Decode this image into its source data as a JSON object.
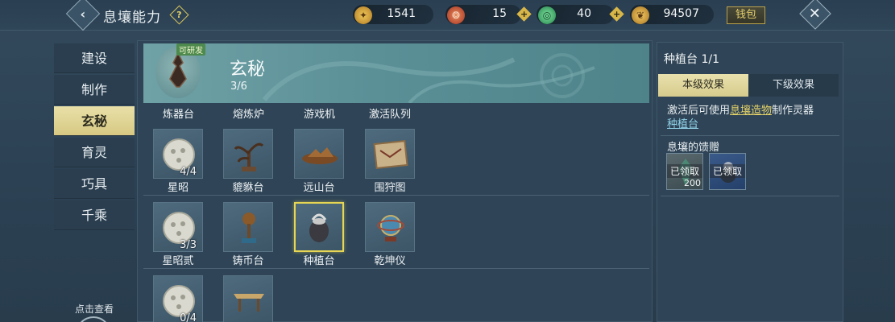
{
  "header": {
    "title": "息壤能力",
    "help_label": "?",
    "back_label": "‹",
    "close_label": "✕",
    "wallet_label": "钱包",
    "resources": [
      {
        "icon": "gold-shell-icon",
        "value": "1541",
        "color": "#d8a238"
      },
      {
        "icon": "red-coin-icon",
        "value": "15",
        "color": "#c9523a"
      },
      {
        "icon": "jade-ring-icon",
        "value": "40",
        "color": "#3fb56a"
      },
      {
        "icon": "gold-leaf-icon",
        "value": "94507",
        "color": "#d6a23c"
      }
    ],
    "plus_label": "+"
  },
  "nav": {
    "items": [
      "建设",
      "制作",
      "玄秘",
      "育灵",
      "巧具",
      "千乘"
    ],
    "active_index": 2,
    "click_view": "点击查看"
  },
  "banner": {
    "badge": "可研发",
    "title": "玄秘",
    "progress": "3/6"
  },
  "grid": {
    "column_headers": [
      "炼器台",
      "熔炼炉",
      "游戏机",
      "激活队列"
    ],
    "rows": [
      [
        {
          "label": "星昭",
          "count": "4/4",
          "icon": "star-disc-icon"
        },
        {
          "label": "貔貅台",
          "count": "",
          "icon": "bonsai-tree-icon"
        },
        {
          "label": "远山台",
          "count": "",
          "icon": "mountain-tray-icon"
        },
        {
          "label": "围狩图",
          "count": "",
          "icon": "hunting-map-icon"
        }
      ],
      [
        {
          "label": "星昭贰",
          "count": "3/3",
          "icon": "star-disc-icon"
        },
        {
          "label": "铸币台",
          "count": "",
          "icon": "coin-stand-icon"
        },
        {
          "label": "种植台",
          "count": "",
          "icon": "planter-pot-icon",
          "selected": true
        },
        {
          "label": "乾坤仪",
          "count": "",
          "icon": "globe-instrument-icon"
        }
      ],
      [
        {
          "label": "",
          "count": "0/4",
          "icon": "star-disc-icon"
        },
        {
          "label": "",
          "count": "",
          "icon": "wooden-table-icon"
        }
      ]
    ]
  },
  "detail": {
    "title": "种植台 1/1",
    "tabs": [
      "本级效果",
      "下级效果"
    ],
    "desc_prefix": "激活后可使用",
    "desc_link": "息壤造物",
    "desc_suffix": "制作灵器",
    "desc_link2": "种植台",
    "gift_title": "息壤的馈赠",
    "rewards": [
      {
        "status": "已领取",
        "count": "200",
        "icon": "jade-crystal-icon"
      },
      {
        "status": "已领取",
        "count": "",
        "icon": "spirit-pet-icon"
      }
    ]
  }
}
